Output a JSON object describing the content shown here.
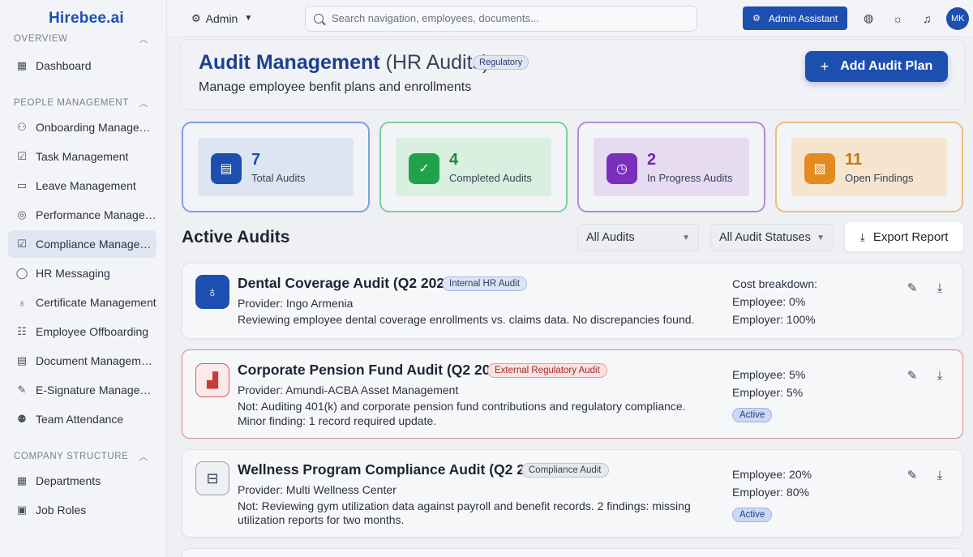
{
  "brand": "Hirebee.ai",
  "sidebar": {
    "sections": [
      {
        "title": "OVERVIEW",
        "items": [
          {
            "label": "Dashboard",
            "icon": "grid-icon"
          }
        ]
      },
      {
        "title": "PEOPLE MANAGEMENT",
        "items": [
          {
            "label": "Onboarding Manageme...",
            "icon": "user-plus-icon"
          },
          {
            "label": "Task Management",
            "icon": "checkbox-icon"
          },
          {
            "label": "Leave Management",
            "icon": "calendar-icon"
          },
          {
            "label": "Performance Managem...",
            "icon": "target-icon"
          },
          {
            "label": "Compliance Manageme...",
            "icon": "checkbox-icon",
            "active": true
          },
          {
            "label": "HR Messaging",
            "icon": "chat-icon"
          },
          {
            "label": "Certificate Management",
            "icon": "award-icon"
          },
          {
            "label": "Employee Offboarding",
            "icon": "list-icon"
          },
          {
            "label": "Document Management",
            "icon": "document-icon"
          },
          {
            "label": "E-Signature Management",
            "icon": "pen-icon"
          },
          {
            "label": "Team Attendance",
            "icon": "users-icon"
          }
        ]
      },
      {
        "title": "COMPANY STRUCTURE",
        "items": [
          {
            "label": "Departments",
            "icon": "grid-icon"
          },
          {
            "label": "Job Roles",
            "icon": "briefcase-icon"
          }
        ]
      }
    ]
  },
  "topbar": {
    "role": "Admin",
    "search_placeholder": "Search navigation, employees, documents...",
    "assistant_label": "Admin Assistant",
    "avatar_initials": "MK"
  },
  "page": {
    "title": "Audit Management",
    "title_suffix": "(HR Audits)",
    "badge": "Regulatory",
    "subtitle": "Manage employee benfit plans and enrollments",
    "add_button": "Add Audit Plan"
  },
  "stats": [
    {
      "value": "7",
      "label": "Total Audits",
      "icon": "document-icon"
    },
    {
      "value": "4",
      "label": "Completed Audits",
      "icon": "check-circle-icon"
    },
    {
      "value": "2",
      "label": "In Progress Audits",
      "icon": "clock-icon"
    },
    {
      "value": "11",
      "label": "Open Findings",
      "icon": "search-document-icon"
    }
  ],
  "audits_section": {
    "title": "Active Audits",
    "filter_type": "All Audits",
    "filter_status": "All Audit Statuses",
    "export_label": "Export Report"
  },
  "audits": [
    {
      "title": "Dental Coverage Audit (Q2 2024)",
      "badge": "Internal HR Audit",
      "provider": "Provider: Ingo Armenia",
      "description": "Reviewing employee dental coverage enrollments vs. claims data. No discrepancies found.",
      "cost_header": "Cost breakdown:",
      "employee": "Employee: 0%",
      "employer": "Employer: 100%",
      "icon": "tooth-icon"
    },
    {
      "title": "Corporate Pension Fund Audit (Q2 2024)",
      "badge": "External Regulatory Audit",
      "provider": "Provider: Amundi-ACBA Asset Management",
      "description": "Not: Auditing 401(k) and corporate pension fund contributions and regulatory compliance.",
      "description2": "Minor finding: 1 record required update.",
      "employee": "Employee: 5%",
      "employer": "Employer: 5%",
      "status": "Active",
      "icon": "growth-chart-icon"
    },
    {
      "title": "Wellness Program Compliance Audit (Q2 2024)",
      "badge": "Compliance Audit",
      "provider": "Provider: Multi Wellness Center",
      "description": "Not: Reviewing gym utilization data against payroll and benefit records. 2 findings: missing",
      "description2": "utilization reports for two months.",
      "employee": "Employee: 20%",
      "employer": "Employer: 80%",
      "status": "Active",
      "icon": "dumbbell-icon"
    }
  ]
}
